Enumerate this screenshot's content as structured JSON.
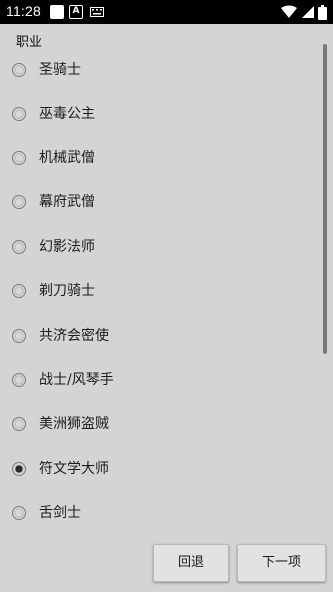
{
  "status_bar": {
    "time": "11:28",
    "icons": [
      "notification-square-icon",
      "a-icon",
      "keyboard-icon",
      "wifi-icon",
      "cellular-icon",
      "battery-icon"
    ]
  },
  "section_title": "职业",
  "options": [
    {
      "label": "圣骑士",
      "checked": false
    },
    {
      "label": "巫毒公主",
      "checked": false
    },
    {
      "label": "机械武僧",
      "checked": false
    },
    {
      "label": "幕府武僧",
      "checked": false
    },
    {
      "label": "幻影法师",
      "checked": false
    },
    {
      "label": "剃刀骑士",
      "checked": false
    },
    {
      "label": "共济会密使",
      "checked": false
    },
    {
      "label": "战士/风琴手",
      "checked": false
    },
    {
      "label": "美洲狮盗贼",
      "checked": false
    },
    {
      "label": "符文学大师",
      "checked": true
    },
    {
      "label": "舌剑士",
      "checked": false
    }
  ],
  "buttons": {
    "back_label": "回退",
    "next_label": "下一项"
  }
}
